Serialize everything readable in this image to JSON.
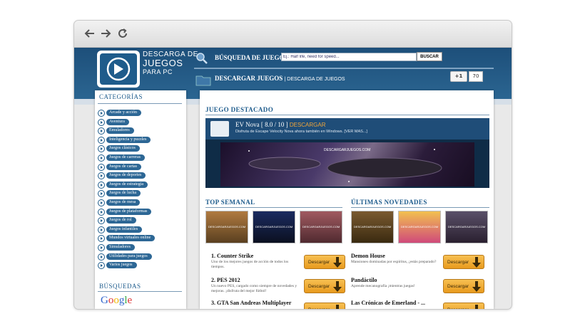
{
  "logo": {
    "line1": "DESCARGA DE",
    "line2": "JUEGOS",
    "line3": "PARA PC"
  },
  "search": {
    "label": "BÚSQUEDA DE JUEGOS:",
    "value": "Ej.: Half life, need for speed...",
    "button": "BUSCAR"
  },
  "header": {
    "title": "DESCARGAR JUEGOS",
    "subtitle": "| DESCARGA DE JUEGOS",
    "gplus_label": "+1",
    "gplus_count": "70"
  },
  "sidebar": {
    "title": "CATEGORÍAS",
    "items": [
      "Arcade y acción",
      "Aventura",
      "Emuladores",
      "Inteligencia y puzzles",
      "Juegos clásicos",
      "Juegos de carreras",
      "Juegos de cartas",
      "Juegos de deportes",
      "Juegos de estrategia",
      "Juegos de lucha",
      "Juegos de mesa",
      "Juegos de plataformas",
      "Juegos de rol",
      "Juegos infantiles",
      "Mundos virtuales online",
      "Simuladores",
      "Utilidades para juegos",
      "Varios juegos"
    ],
    "searches_title": "BÚSQUEDAS",
    "google_label": "Google"
  },
  "featured": {
    "section_title": "JUEGO DESTACADO",
    "name": "EV Nova [ 8.0 / 10 ]",
    "download": "DESCARGAR",
    "description": "Disfruta de Escape Velocity Nova ahora también en Windows. [VER MAS...]",
    "watermark": "DESCARGARJUEGOS.COM"
  },
  "top": {
    "title": "TOP SEMANAL",
    "thumb_watermark": "DESCARGARJUEGOS.COM",
    "games": [
      {
        "name": "1. Counter Strike",
        "desc": "Uno de los mejores juegos de acción de todos los tiempos."
      },
      {
        "name": "2. PES 2012",
        "desc": "Un nuevo PES, cargado como siempre de novedades y mejoras. ¡disfruta del mejor fútbol!"
      },
      {
        "name": "3. GTA San Andreas Multiplayer",
        "desc": ""
      }
    ]
  },
  "latest": {
    "title": "ÚLTIMAS NOVEDADES",
    "games": [
      {
        "name": "Demon House",
        "desc": "Mansiones dominadas por espíritus, ¿estás preparado?"
      },
      {
        "name": "Pandáctilo",
        "desc": "Aprende mecanografía ¡mientras juegas!"
      },
      {
        "name": "Las Crónicas de Emerland - ...",
        "desc": ""
      }
    ]
  },
  "download_label": "Descargar",
  "colors": {
    "header": "#1d4f7a",
    "pill": "#2d6795",
    "accent": "#f0a53a",
    "title": "#1d5b8c"
  }
}
